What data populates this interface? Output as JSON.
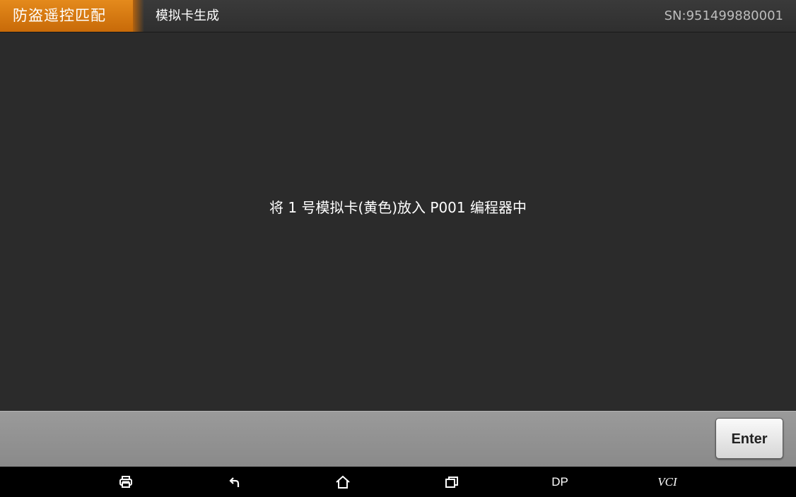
{
  "header": {
    "module_label": "防盗遥控匹配",
    "page_title": "模拟卡生成",
    "serial": "SN:951499880001"
  },
  "main": {
    "instruction": "将 1 号模拟卡(黄色)放入 P001 编程器中"
  },
  "actions": {
    "enter_label": "Enter"
  },
  "navbar": {
    "items": [
      {
        "icon": "print-icon"
      },
      {
        "icon": "back-icon"
      },
      {
        "icon": "home-icon"
      },
      {
        "icon": "recent-apps-icon"
      },
      {
        "label": "DP"
      },
      {
        "label": "VCI"
      }
    ]
  },
  "colors": {
    "module_tab": "#d97a10",
    "background": "#2b2b2b",
    "action_bar": "#929292",
    "navbar": "#000000"
  }
}
